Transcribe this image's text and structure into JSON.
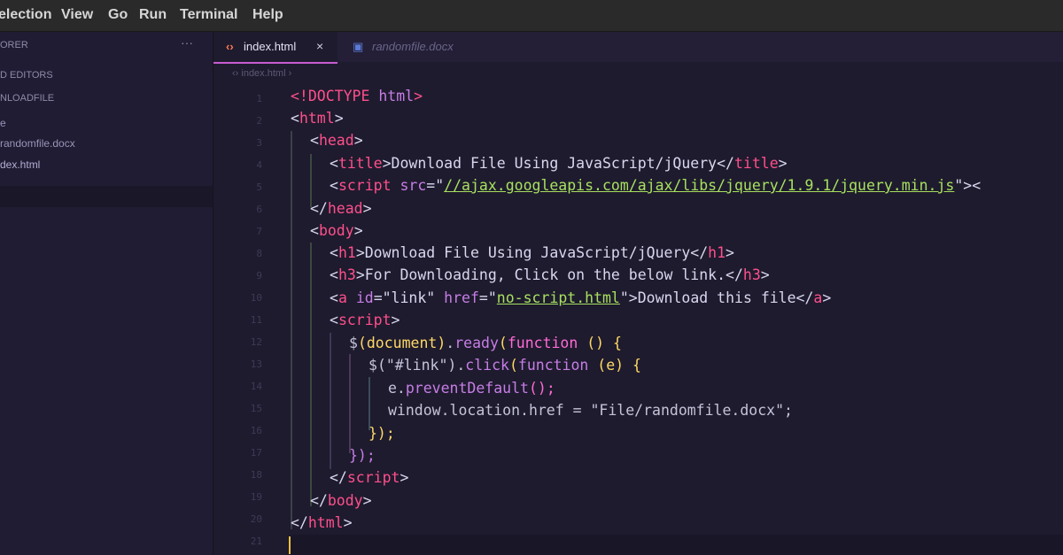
{
  "menu": [
    "election",
    "View",
    "Go",
    "Run",
    "Terminal",
    "Help"
  ],
  "sidebar": {
    "header": "ORER",
    "sections": [
      "D EDITORS",
      "NLOADFILE"
    ],
    "items": [
      "e",
      "randomfile.docx",
      "dex.html"
    ],
    "active_item": 2
  },
  "tabs": [
    {
      "label": "index.html",
      "icon": "html-icon",
      "active": true,
      "close": "×"
    },
    {
      "label": "randomfile.docx",
      "icon": "file-icon",
      "active": false
    }
  ],
  "breadcrumb": "‹› index.html ›",
  "line_numbers": [
    "1",
    "2",
    "3",
    "4",
    "5",
    "6",
    "7",
    "8",
    "9",
    "10",
    "11",
    "12",
    "13",
    "14",
    "15",
    "16",
    "17",
    "18",
    "19",
    "20",
    "21"
  ],
  "code": {
    "l1": [
      "<!",
      "DOCTYPE",
      " ",
      "html",
      ">"
    ],
    "l2": [
      "<",
      "html",
      ">"
    ],
    "l3": [
      "<",
      "head",
      ">"
    ],
    "l4": [
      "<",
      "title",
      ">Download File Using JavaScript/jQuery</",
      "title",
      ">"
    ],
    "l5": [
      "<",
      "script",
      " ",
      "src",
      "=\"",
      "//ajax.googleapis.com/ajax/libs/jquery/1.9.1/jquery.min.js",
      "\"><"
    ],
    "l6": [
      "</",
      "head",
      ">"
    ],
    "l7": [
      "<",
      "body",
      ">"
    ],
    "l8": [
      "<",
      "h1",
      ">Download File Using JavaScript/jQuery</",
      "h1",
      ">"
    ],
    "l9": [
      "<",
      "h3",
      ">For Downloading, Click on the below link.</",
      "h3",
      ">"
    ],
    "l10": [
      "<",
      "a",
      " ",
      "id",
      "=\"link\" ",
      "href",
      "=\"",
      "no-script.html",
      "\">Download this file</",
      "a",
      ">"
    ],
    "l11": [
      "<",
      "script",
      ">"
    ],
    "l12": [
      "$",
      "(document)",
      ".",
      "ready",
      "(",
      "function",
      " () {"
    ],
    "l13": [
      "$",
      "(\"#link\")",
      ".",
      "click",
      "(",
      "function",
      " (e) {"
    ],
    "l14": [
      "e.",
      "preventDefault",
      "();"
    ],
    "l15": [
      "window.location.href = \"File/randomfile.docx\";"
    ],
    "l16": [
      "});"
    ],
    "l17": [
      "});"
    ],
    "l18": [
      "</",
      "script",
      ">"
    ],
    "l19": [
      "</",
      "body",
      ">"
    ],
    "l20": [
      "</",
      "html",
      ">"
    ]
  },
  "colors": {
    "tag": "#ff4f8b",
    "attr": "#c77de6",
    "string": "#a8e05f",
    "text": "#d9d7ef",
    "cursor": "#f0c040"
  }
}
